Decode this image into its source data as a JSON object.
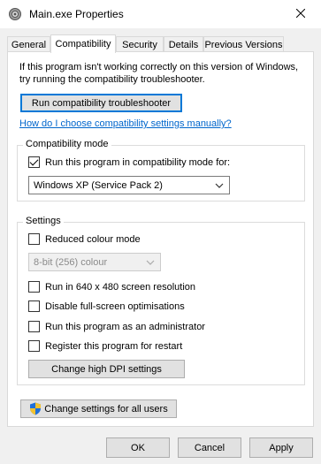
{
  "window": {
    "title": "Main.exe Properties",
    "icon": "gear-icon"
  },
  "tabs": [
    {
      "label": "General",
      "active": false
    },
    {
      "label": "Compatibility",
      "active": true
    },
    {
      "label": "Security",
      "active": false
    },
    {
      "label": "Details",
      "active": false
    },
    {
      "label": "Previous Versions",
      "active": false
    }
  ],
  "intro": {
    "line1": "If this program isn't working correctly on this version of Windows,",
    "line2": "try running the compatibility troubleshooter."
  },
  "troubleshooter_label": "Run compatibility troubleshooter",
  "help_link": "How do I choose compatibility settings manually?",
  "compat_mode": {
    "group_label": "Compatibility mode",
    "checkbox_label": "Run this program in compatibility mode for:",
    "checked": true,
    "selected_os": "Windows XP (Service Pack 2)"
  },
  "settings": {
    "group_label": "Settings",
    "reduced_colour": {
      "label": "Reduced colour mode",
      "checked": false
    },
    "colour_select": "8-bit (256) colour",
    "res_640": {
      "label": "Run in 640 x 480 screen resolution",
      "checked": false
    },
    "disable_fullscreen": {
      "label": "Disable full-screen optimisations",
      "checked": false
    },
    "run_admin": {
      "label": "Run this program as an administrator",
      "checked": false
    },
    "register_restart": {
      "label": "Register this program for restart",
      "checked": false
    },
    "dpi_button": "Change high DPI settings"
  },
  "all_users_button": "Change settings for all users",
  "footer": {
    "ok": "OK",
    "cancel": "Cancel",
    "apply": "Apply"
  },
  "colors": {
    "accent": "#0078d7",
    "link": "#0066cc",
    "shield_blue": "#1e6fd9",
    "shield_yellow": "#f2c230"
  }
}
